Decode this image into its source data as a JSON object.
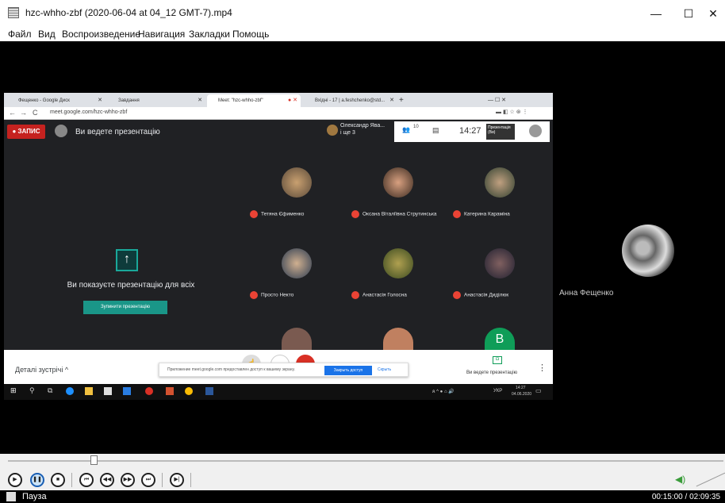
{
  "window": {
    "title": "hzc-whho-zbf (2020-06-04 at 04_12 GMT-7).mp4",
    "minimize": "—",
    "maximize": "☐",
    "close": "✕"
  },
  "menu": [
    "Файл",
    "Вид",
    "Воспроизведение",
    "Навигация",
    "Закладки",
    "Помощь"
  ],
  "browser": {
    "tabs": [
      {
        "label": "Фещенко - Google Диск"
      },
      {
        "label": "Завдання"
      },
      {
        "label": "Meet: \"hzc-whho-zbf\""
      },
      {
        "label": "Вхідні - 17 | a.feshchenko@std..."
      }
    ],
    "url": "meet.google.com/hzc-whho-zbf",
    "win_controls": "—   ☐   ✕"
  },
  "meet": {
    "rec_label": "● ЗАПИС",
    "presenting_label": "Ви ведете презентацію",
    "presenter_name": "Олександр Ява...",
    "presenter_more": "і ще 3",
    "people_count": "10",
    "clock": "14:27",
    "present_badge": "Презентація (Ви)",
    "share_text": "Ви показуєте презентацію для всіх",
    "stop_button": "Зупинити презентацію",
    "participants": [
      {
        "name": "Тетяна Єфименко"
      },
      {
        "name": "Оксана Віталіївна Струтинська"
      },
      {
        "name": "Катерина Караміна"
      },
      {
        "name": "Просто Некто"
      },
      {
        "name": "Анастасія Голосна"
      },
      {
        "name": "Анастасія Диділюк"
      }
    ],
    "b_avatar": "B",
    "details_label": "Деталі зустрічі ^",
    "notice_text": "Приложение meet.google.com предоставлен доступ к вашему экрану.",
    "notice_btn": "Закрыть доступ",
    "notice_hide": "Скрыть",
    "present_bottom": "Ви ведете презентацію",
    "more": "⋮"
  },
  "taskbar": {
    "lang": "УКР",
    "time": "14:27",
    "date": "04.06.2020"
  },
  "side_participant": {
    "name": "Анна Фещенко"
  },
  "player": {
    "status": "Пауза",
    "time": "00:15:00 / 02:09:35"
  },
  "colors": {
    "rec": "#c5221f",
    "teal": "#1a9688",
    "blue": "#1a73e8",
    "mic": "#ea4335"
  }
}
